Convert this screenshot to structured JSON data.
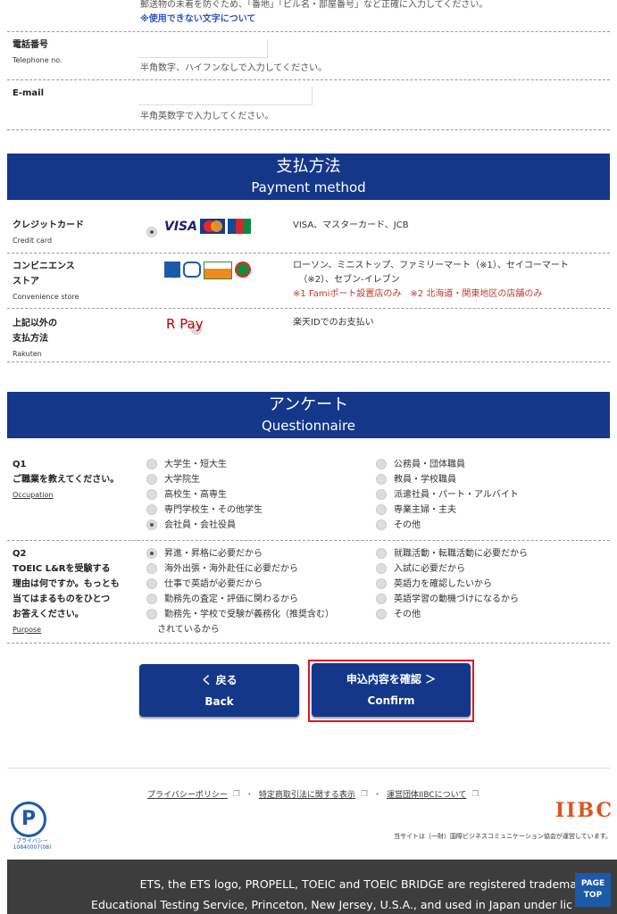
{
  "contact": {
    "address_note": "郵送物の未着を防ぐため、「番地」「ビル名・部屋番号」など正確に入力してください。",
    "unusable_link": "※使用できない文字について",
    "tel_label": "電話番号",
    "tel_en": "Telephone no.",
    "tel_value": "",
    "tel_hint": "半角数字、ハイフンなしで入力してください。",
    "email_label": "E-mail",
    "email_value": "",
    "email_hint": "半角英数字で入力してください。"
  },
  "payment": {
    "title_ja": "支払方法",
    "title_en": "Payment method",
    "options": [
      {
        "label": "クレジットカード",
        "en": "Credit card",
        "selected": true,
        "desc": "VISA、マスターカード、JCB",
        "logos": "VISA"
      },
      {
        "label": "コンビニエンス",
        "label2": "ストア",
        "en": "Convenience store",
        "selected": false,
        "desc": "ローソン、ミニストップ、ファミリーマート（※1）、セイコーマート",
        "desc2": "（※2）、セブン-イレブン",
        "note": "※1 Famiポート設置店のみ　※2 北海道・関東地区の店舗のみ"
      },
      {
        "label": "上記以外の",
        "label2": "支払方法",
        "en": "Rakuten",
        "selected": false,
        "desc": "楽天IDでのお支払い",
        "logos": "R Pay"
      }
    ]
  },
  "questionnaire": {
    "title_ja": "アンケート",
    "title_en": "Questionnaire",
    "q1": {
      "num": "Q1",
      "text": "ご職業を教えてください。",
      "en": "Occupation",
      "left": [
        "大学生・短大生",
        "大学院生",
        "高校生・高専生",
        "専門学校生・その他学生",
        "会社員・会社役員"
      ],
      "right": [
        "公務員・団体職員",
        "教員・学校職員",
        "派遣社員・パート・アルバイト",
        "専業主婦・主夫",
        "その他"
      ],
      "selected": "会社員・会社役員"
    },
    "q2": {
      "num": "Q2",
      "lines": [
        "TOEIC L&Rを受験する",
        "理由は何ですか。もっとも",
        "当てはまるものをひとつ",
        "お答えください。"
      ],
      "en": "Purpose",
      "left": [
        "昇進・昇格に必要だから",
        "海外出張・海外赴任に必要だから",
        "仕事で英語が必要だから",
        "勤務先の査定・評価に関わるから",
        "勤務先・学校で受験が義務化（推奨含む）"
      ],
      "left_cont": "されているから",
      "right": [
        "就職活動・転職活動に必要だから",
        "入試に必要だから",
        "英語力を確認したいから",
        "英語学習の動機づけになるから",
        "その他"
      ],
      "selected": "昇進・昇格に必要だから"
    }
  },
  "buttons": {
    "back_ja": "く 戻る",
    "back_en": "Back",
    "confirm_ja": "申込内容を確認 ＞",
    "confirm_en": "Confirm"
  },
  "footer": {
    "links": [
      "プライバシーポリシー",
      "特定商取引法に関する表示",
      "運営団体IIBCについて"
    ],
    "privacy_mark": "プライバシー 10840007(08)",
    "iibc_logo": "IIBC",
    "operated": "当サイトは（一財）国際ビジネスコミュニケーション協会が運営しています。",
    "trademark1": "ETS, the ETS logo, PROPELL, TOEIC and TOEIC BRIDGE are registered tradema",
    "trademark2": "Educational Testing Service, Princeton, New Jersey, U.S.A., and used in Japan under lic",
    "page_top": "PAGE TOP"
  },
  "colors": {
    "brand": "#15378a",
    "highlight": "#e0141e",
    "note": "#c0392b"
  }
}
